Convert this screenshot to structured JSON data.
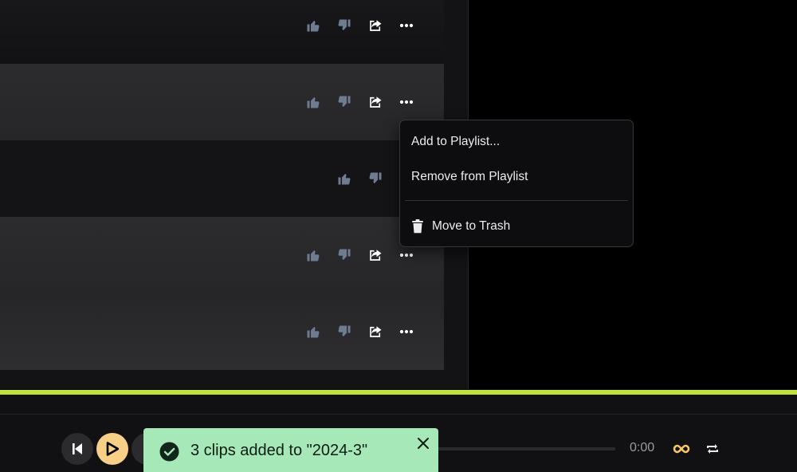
{
  "clip_rows": [
    {
      "like_icon": "thumbs-up-icon",
      "dislike_icon": "thumbs-down-icon",
      "share_icon": "share-icon",
      "more_icon": "more-icon"
    },
    {
      "like_icon": "thumbs-up-icon",
      "dislike_icon": "thumbs-down-icon",
      "share_icon": "share-icon",
      "more_icon": "more-icon"
    },
    {
      "like_icon": "thumbs-up-icon",
      "dislike_icon": "thumbs-down-icon",
      "share_icon": "share-icon",
      "more_icon": "more-icon"
    },
    {
      "like_icon": "thumbs-up-icon",
      "dislike_icon": "thumbs-down-icon",
      "share_icon": "share-icon",
      "more_icon": "more-icon"
    },
    {
      "like_icon": "thumbs-up-icon",
      "dislike_icon": "thumbs-down-icon",
      "share_icon": "share-icon",
      "more_icon": "more-icon"
    }
  ],
  "context_menu": {
    "add_to_playlist": "Add to Playlist...",
    "remove_from_playlist": "Remove from Playlist",
    "move_to_trash": "Move to Trash"
  },
  "player": {
    "current_time": "0:00",
    "accent_color": "#c2e03a",
    "play_button_color": "#f7cf86",
    "loop_icon_color": "#f5c66a"
  },
  "toast": {
    "message": "3 clips added to \"2024-3\"",
    "background_color": "#a7e8b8"
  }
}
